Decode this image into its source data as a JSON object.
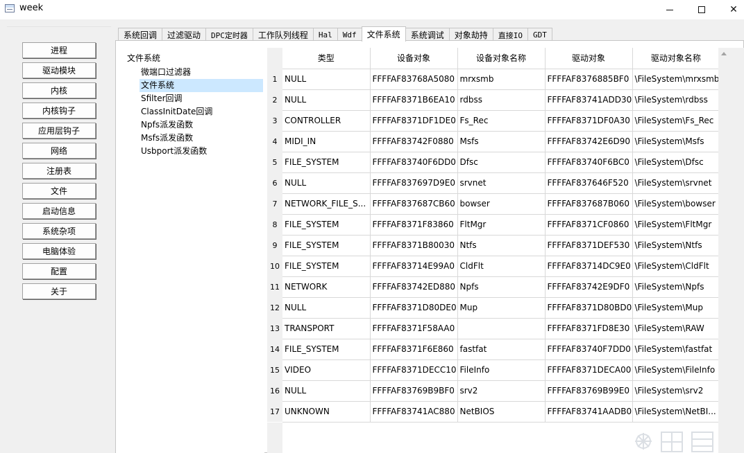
{
  "window": {
    "title": "week",
    "min_glyph": "",
    "close_glyph": "✕"
  },
  "nav": {
    "items": [
      "进程",
      "驱动模块",
      "内核",
      "内核钩子",
      "应用层钩子",
      "网络",
      "注册表",
      "文件",
      "启动信息",
      "系统杂项",
      "电脑体验",
      "配置",
      "关于"
    ]
  },
  "tabs": {
    "items": [
      "系统回调",
      "过滤驱动",
      "DPC定时器",
      "工作队列线程",
      "Hal",
      "Wdf",
      "文件系统",
      "系统调试",
      "对象劫持",
      "直接IO",
      "GDT"
    ],
    "active_index": 6
  },
  "tree": {
    "root": "文件系统",
    "items": [
      "微端口过滤器",
      "文件系统",
      "Sfilter回调",
      "ClassInitDate回调",
      "Npfs派发函数",
      "Msfs派发函数",
      "Usbport派发函数"
    ],
    "selected_index": 1
  },
  "table": {
    "columns": [
      "类型",
      "设备对象",
      "设备对象名称",
      "驱动对象",
      "驱动对象名称"
    ],
    "rows": [
      [
        "1",
        "NULL",
        "FFFFAF83768A5080",
        "mrxsmb",
        "FFFFAF8376885BF0",
        "\\FileSystem\\mrxsmb"
      ],
      [
        "2",
        "NULL",
        "FFFFAF8371B6EA10",
        "rdbss",
        "FFFFAF83741ADD30",
        "\\FileSystem\\rdbss"
      ],
      [
        "3",
        "CONTROLLER",
        "FFFFAF8371DF1DE0",
        "Fs_Rec",
        "FFFFAF8371DF0A30",
        "\\FileSystem\\Fs_Rec"
      ],
      [
        "4",
        "MIDI_IN",
        "FFFFAF83742F0880",
        "Msfs",
        "FFFFAF83742E6D90",
        "\\FileSystem\\Msfs"
      ],
      [
        "5",
        "FILE_SYSTEM",
        "FFFFAF83740F6DD0",
        "Dfsc",
        "FFFFAF83740F6BC0",
        "\\FileSystem\\Dfsc"
      ],
      [
        "6",
        "NULL",
        "FFFFAF837697D9E0",
        "srvnet",
        "FFFFAF837646F520",
        "\\FileSystem\\srvnet"
      ],
      [
        "7",
        "NETWORK_FILE_S...",
        "FFFFAF837687CB60",
        "bowser",
        "FFFFAF837687B060",
        "\\FileSystem\\bowser"
      ],
      [
        "8",
        "FILE_SYSTEM",
        "FFFFAF8371F83860",
        "FltMgr",
        "FFFFAF8371CF0860",
        "\\FileSystem\\FltMgr"
      ],
      [
        "9",
        "FILE_SYSTEM",
        "FFFFAF8371B80030",
        "Ntfs",
        "FFFFAF8371DEF530",
        "\\FileSystem\\Ntfs"
      ],
      [
        "10",
        "FILE_SYSTEM",
        "FFFFAF83714E99A0",
        "CldFlt",
        "FFFFAF83714DC9E0",
        "\\FileSystem\\CldFlt"
      ],
      [
        "11",
        "NETWORK",
        "FFFFAF83742ED880",
        "Npfs",
        "FFFFAF83742E9DF0",
        "\\FileSystem\\Npfs"
      ],
      [
        "12",
        "NULL",
        "FFFFAF8371D80DE0",
        "Mup",
        "FFFFAF8371D80BD0",
        "\\FileSystem\\Mup"
      ],
      [
        "13",
        "TRANSPORT",
        "FFFFAF8371F58AA0",
        "",
        "FFFFAF8371FD8E30",
        "\\FileSystem\\RAW"
      ],
      [
        "14",
        "FILE_SYSTEM",
        "FFFFAF8371F6E860",
        "fastfat",
        "FFFFAF83740F7DD0",
        "\\FileSystem\\fastfat"
      ],
      [
        "15",
        "VIDEO",
        "FFFFAF8371DECC10",
        "FileInfo",
        "FFFFAF8371DECA00",
        "\\FileSystem\\FileInfo"
      ],
      [
        "16",
        "NULL",
        "FFFFAF83769B9BF0",
        "srv2",
        "FFFFAF83769B99E0",
        "\\FileSystem\\srv2"
      ],
      [
        "17",
        "UNKNOWN",
        "FFFFAF83741AC880",
        "NetBIOS",
        "FFFFAF83741AADB0",
        "\\FileSystem\\NetBI..."
      ]
    ]
  },
  "colors": {
    "selection": "#cce8ff",
    "background": "#f0f0f0"
  }
}
